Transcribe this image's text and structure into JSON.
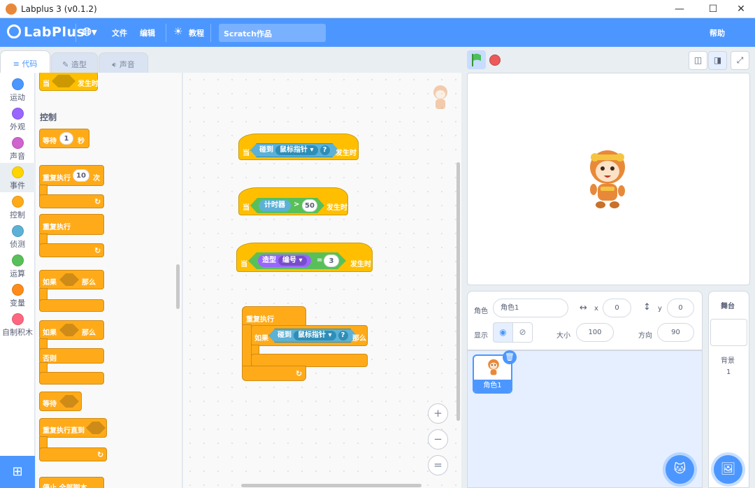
{
  "window": {
    "title": "Labplus 3 (v0.1.2)",
    "minimize": "—",
    "maximize": "☐",
    "close": "✕"
  },
  "menubar": {
    "brand": "LabPlus",
    "globe_icon": "globe-icon",
    "file": "文件",
    "edit": "编辑",
    "tutorial": "教程",
    "project_title": "Scratch作品",
    "help": "帮助"
  },
  "tabs": [
    {
      "label": "代码",
      "icon": "code-icon"
    },
    {
      "label": "造型",
      "icon": "brush-icon"
    },
    {
      "label": "声音",
      "icon": "speaker-icon"
    }
  ],
  "categories": [
    {
      "label": "运动",
      "color": "#4c97ff"
    },
    {
      "label": "外观",
      "color": "#9966ff"
    },
    {
      "label": "声音",
      "color": "#cf63cf"
    },
    {
      "label": "事件",
      "color": "#ffd500"
    },
    {
      "label": "控制",
      "color": "#ffab19"
    },
    {
      "label": "侦测",
      "color": "#5cb1d6"
    },
    {
      "label": "运算",
      "color": "#59c059"
    },
    {
      "label": "变量",
      "color": "#ff8c1a"
    },
    {
      "label": "自制积木",
      "color": "#ff6680"
    }
  ],
  "flyout": {
    "event_top": {
      "prefix": "当",
      "suffix": "发生时"
    },
    "section_title": "控制",
    "wait": {
      "label": "等待",
      "value": "1",
      "unit": "秒"
    },
    "repeat": {
      "label": "重复执行",
      "value": "10",
      "unit": "次"
    },
    "forever": {
      "label": "重复执行"
    },
    "if_then": {
      "prefix": "如果",
      "suffix": "那么"
    },
    "if_else": {
      "prefix": "如果",
      "suffix": "那么",
      "else": "否则"
    },
    "wait_until": {
      "label": "等待"
    },
    "repeat_until": {
      "label": "重复执行直到"
    },
    "partial": "停止 全部脚本"
  },
  "scripts": {
    "s1": {
      "prefix": "当",
      "sensor": "碰到",
      "dropdown": "鼠标指针 ▾",
      "q": "?",
      "suffix": "发生时"
    },
    "s2": {
      "prefix": "当",
      "reporter": "计时器",
      "op": ">",
      "value": "50",
      "suffix": "发生时"
    },
    "s3": {
      "prefix": "当",
      "looks": "造型",
      "dropdown": "编号 ▾",
      "op": "=",
      "value": "3",
      "suffix": "发生时"
    },
    "s4": {
      "loop": "重复执行",
      "if": "如果",
      "sensor": "碰到",
      "dropdown": "鼠标指针 ▾",
      "q": "?",
      "then": "那么"
    }
  },
  "zoom": {
    "in": "+",
    "out": "−",
    "reset": "="
  },
  "sprite_info": {
    "sprite_label": "角色",
    "sprite_name": "角色1",
    "x_label": "x",
    "x": "0",
    "y_label": "y",
    "y": "0",
    "show_label": "显示",
    "size_label": "大小",
    "size": "100",
    "direction_label": "方向",
    "direction": "90"
  },
  "sprites": [
    {
      "name": "角色1"
    }
  ],
  "stage_panel": {
    "title": "舞台",
    "backdrops_label": "背景",
    "backdrops_count": "1"
  }
}
